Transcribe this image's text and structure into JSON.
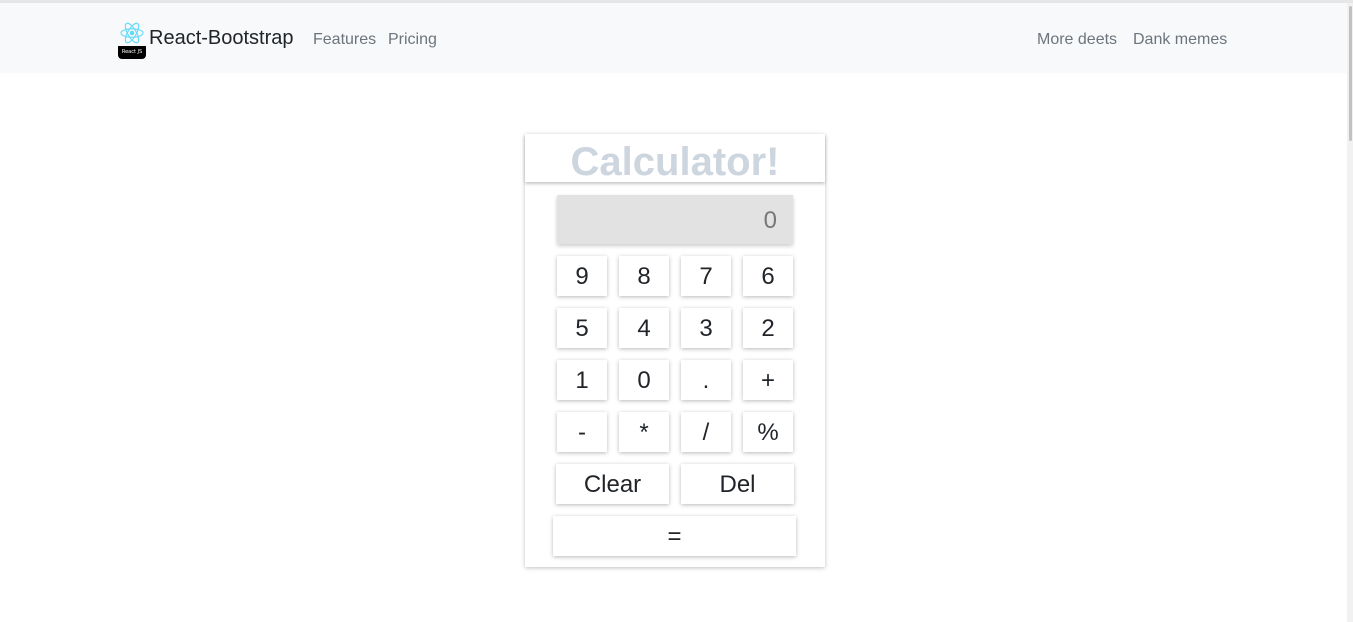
{
  "navbar": {
    "brand": "React-Bootstrap",
    "logo_badge": "React JS",
    "links_left": [
      "Features",
      "Pricing"
    ],
    "links_right": [
      "More deets",
      "Dank memes"
    ]
  },
  "calculator": {
    "title": "Calculator!",
    "display_value": "0",
    "keys": {
      "k9": "9",
      "k8": "8",
      "k7": "7",
      "k6": "6",
      "k5": "5",
      "k4": "4",
      "k3": "3",
      "k2": "2",
      "k1": "1",
      "k0": "0",
      "dot": ".",
      "plus": "+",
      "minus": "-",
      "multiply": "*",
      "divide": "/",
      "percent": "%",
      "clear": "Clear",
      "del": "Del",
      "equals": "="
    }
  },
  "colors": {
    "navbar_bg": "#f8f9fa",
    "title_color": "#cdd5de",
    "display_bg": "#e2e2e2",
    "react_logo": "#61dafb"
  }
}
